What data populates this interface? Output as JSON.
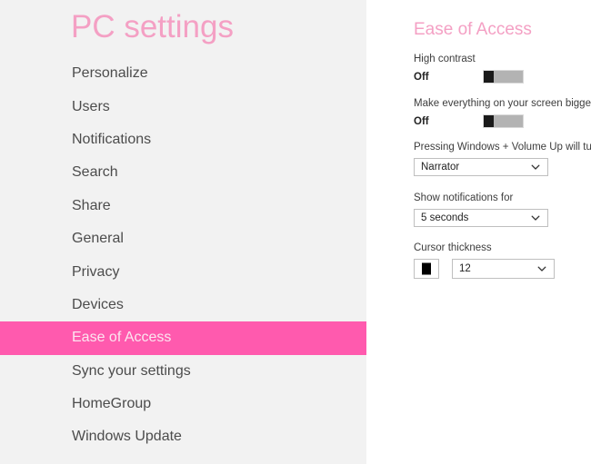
{
  "app": {
    "title": "PC settings"
  },
  "sidebar": {
    "items": [
      {
        "label": "Personalize",
        "selected": false
      },
      {
        "label": "Users",
        "selected": false
      },
      {
        "label": "Notifications",
        "selected": false
      },
      {
        "label": "Search",
        "selected": false
      },
      {
        "label": "Share",
        "selected": false
      },
      {
        "label": "General",
        "selected": false
      },
      {
        "label": "Privacy",
        "selected": false
      },
      {
        "label": "Devices",
        "selected": false
      },
      {
        "label": "Ease of Access",
        "selected": true
      },
      {
        "label": "Sync your settings",
        "selected": false
      },
      {
        "label": "HomeGroup",
        "selected": false
      },
      {
        "label": "Windows Update",
        "selected": false
      }
    ]
  },
  "detail": {
    "title": "Ease of Access",
    "high_contrast": {
      "label": "High contrast",
      "state": "Off",
      "toggle_icon": "toggle-switch-off-icon"
    },
    "screen_bigger": {
      "label": "Make everything on your screen bigger",
      "state": "Off",
      "toggle_icon": "toggle-switch-off-icon"
    },
    "win_volume_shortcut": {
      "label": "Pressing Windows + Volume Up will turn on",
      "value": "Narrator",
      "chevron_icon": "chevron-down-icon"
    },
    "notification_duration": {
      "label": "Show notifications for",
      "value": "5 seconds",
      "chevron_icon": "chevron-down-icon"
    },
    "cursor_thickness": {
      "label": "Cursor thickness",
      "preview_icon": "cursor-thickness-preview-icon",
      "value": "12",
      "chevron_icon": "chevron-down-icon"
    }
  },
  "colors": {
    "accent_pink": "#ff5aae",
    "title_pink": "#f4a0c4",
    "sidebar_bg": "#f2f2f2",
    "panel_bg": "#ffffff",
    "toggle_track": "#b3b3b3",
    "toggle_thumb": "#1a1a1a"
  }
}
